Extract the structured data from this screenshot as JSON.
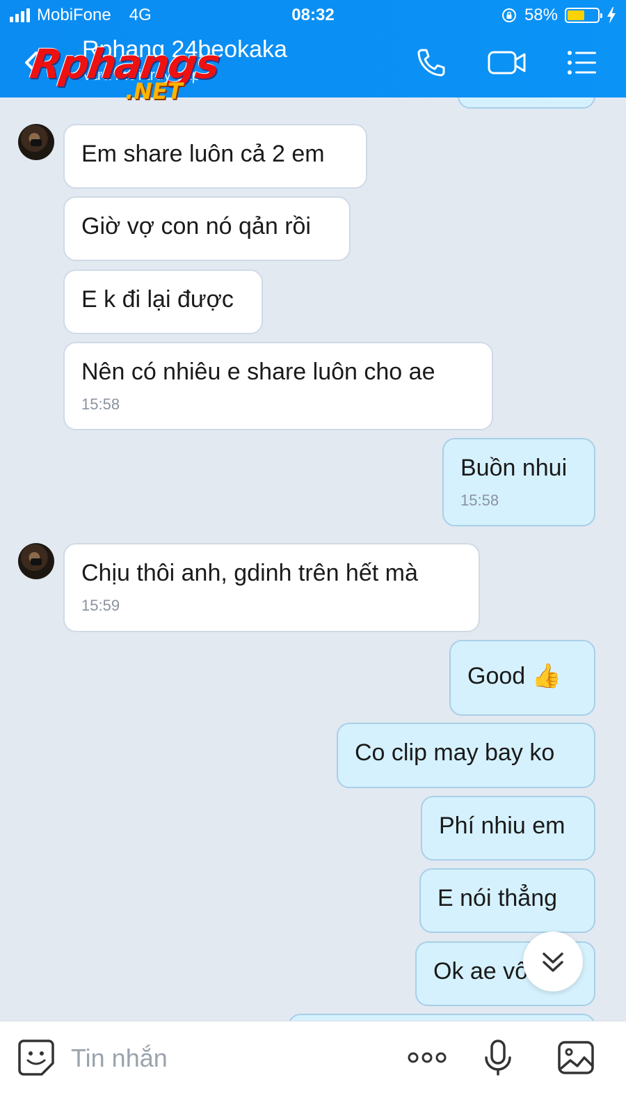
{
  "status_bar": {
    "carrier": "MobiFone",
    "network": "4G",
    "time": "08:32",
    "battery": "58%",
    "battery_level": 0.58
  },
  "header": {
    "contact_name": "Rphang 24beokaka",
    "contact_status": "Vừa mới truy cập",
    "watermark": "Rphangs",
    "watermark_suffix": ".NET"
  },
  "messages": [
    {
      "sender": "them",
      "text": "Em share luôn cả 2 em",
      "time": ""
    },
    {
      "sender": "them",
      "text": "Giờ vợ con nó qản rồi",
      "time": ""
    },
    {
      "sender": "them",
      "text": "E k đi lại được",
      "time": ""
    },
    {
      "sender": "them",
      "text": "Nên có nhiêu e share luôn cho ae",
      "time": "15:58"
    },
    {
      "sender": "me",
      "text": "Buồn nhui",
      "time": "15:58"
    },
    {
      "sender": "them",
      "text": "Chịu thôi anh, gdinh trên hết mà",
      "time": "15:59"
    },
    {
      "sender": "me",
      "text": "Good 👍",
      "time": ""
    },
    {
      "sender": "me",
      "text": "Co clip may bay ko",
      "time": ""
    },
    {
      "sender": "me",
      "text": "Phí nhiu em",
      "time": ""
    },
    {
      "sender": "me",
      "text": "E nói thẳng",
      "time": ""
    },
    {
      "sender": "me",
      "text": "Ok ae vô",
      "time": ""
    }
  ],
  "input": {
    "placeholder": "Tin nhắn"
  },
  "colors": {
    "header": "#0b8ff4",
    "incoming": "#ffffff",
    "outgoing": "#d5f1fd",
    "background": "#e2e9f1"
  }
}
